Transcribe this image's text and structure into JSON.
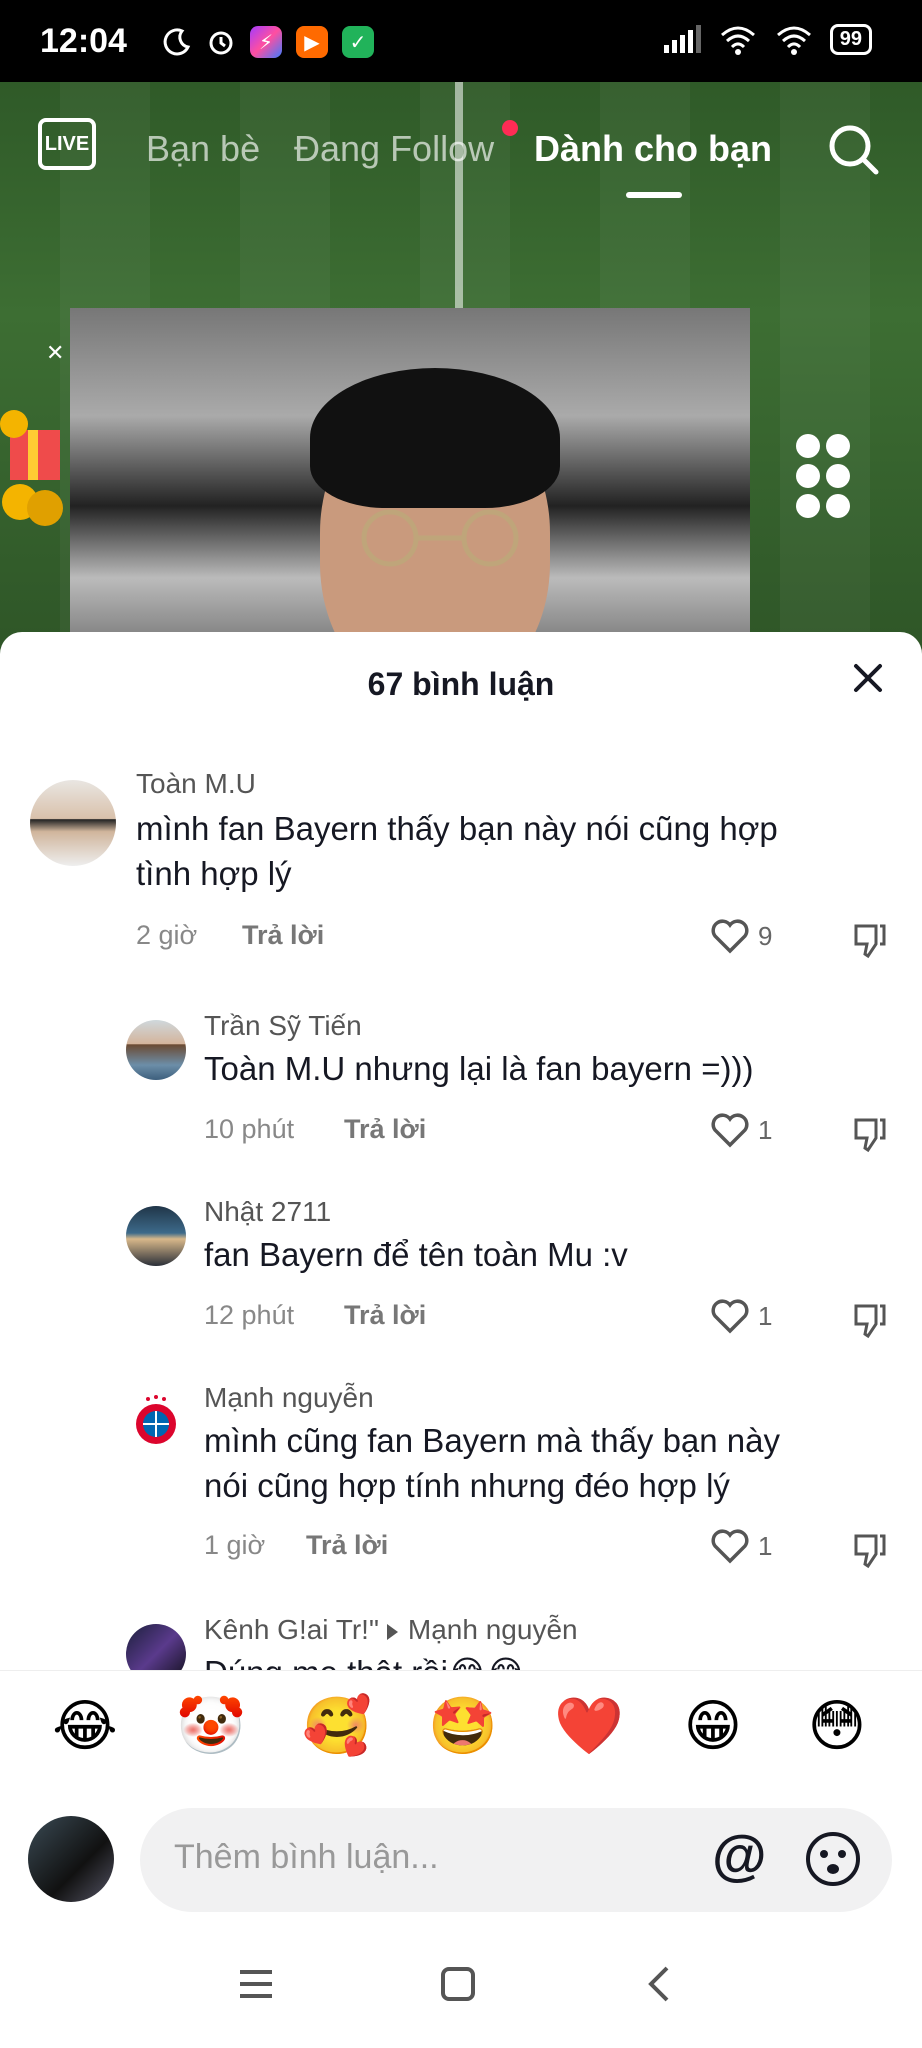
{
  "status_bar": {
    "time": "12:04",
    "battery": "99"
  },
  "top_nav": {
    "live_label": "LIVE",
    "tabs": [
      {
        "label": "Bạn bè"
      },
      {
        "label": "Đang Follow"
      },
      {
        "label": "Dành cho bạn"
      }
    ],
    "active_tab": "Dành cho bạn"
  },
  "comments_sheet": {
    "title": "67 bình luận",
    "comments": [
      {
        "user": "Toàn M.U",
        "text_lines": [
          "mình fan Bayern thấy bạn này nói cũng hợp",
          "tình hợp lý"
        ],
        "time": "2 giờ",
        "reply": "Trả lời",
        "likes": "9"
      },
      {
        "user": "Trần Sỹ Tiến",
        "text_lines": [
          "Toàn M.U nhưng lại là fan bayern =)))"
        ],
        "time": "10 phút",
        "reply": "Trả lời",
        "likes": "1"
      },
      {
        "user": "Nhật 2711",
        "text_lines": [
          "fan Bayern để tên toàn Mu :v"
        ],
        "time": "12 phút",
        "reply": "Trả lời",
        "likes": "1"
      },
      {
        "user": "Mạnh nguyễn",
        "text_lines": [
          "mình cũng fan Bayern mà thấy bạn này",
          "nói cũng hợp tính nhưng đéo hợp lý"
        ],
        "time": "1 giờ",
        "reply": "Trả lời",
        "likes": "1"
      },
      {
        "user": "Kênh G!ai Tr!\"",
        "reply_to": "Mạnh nguyễn",
        "text_lines": [
          "Đúng mẹ thật rồi😂😂"
        ]
      }
    ]
  },
  "emoji_bar": {
    "emojis": [
      "😂",
      "🤡",
      "🥰",
      "🤩",
      "❤️",
      "😁",
      "😳"
    ]
  },
  "composer": {
    "placeholder": "Thêm bình luận...",
    "at_symbol": "@"
  },
  "colors": {
    "accent": "#fe2c55",
    "text": "#161823",
    "muted": "#888888"
  }
}
